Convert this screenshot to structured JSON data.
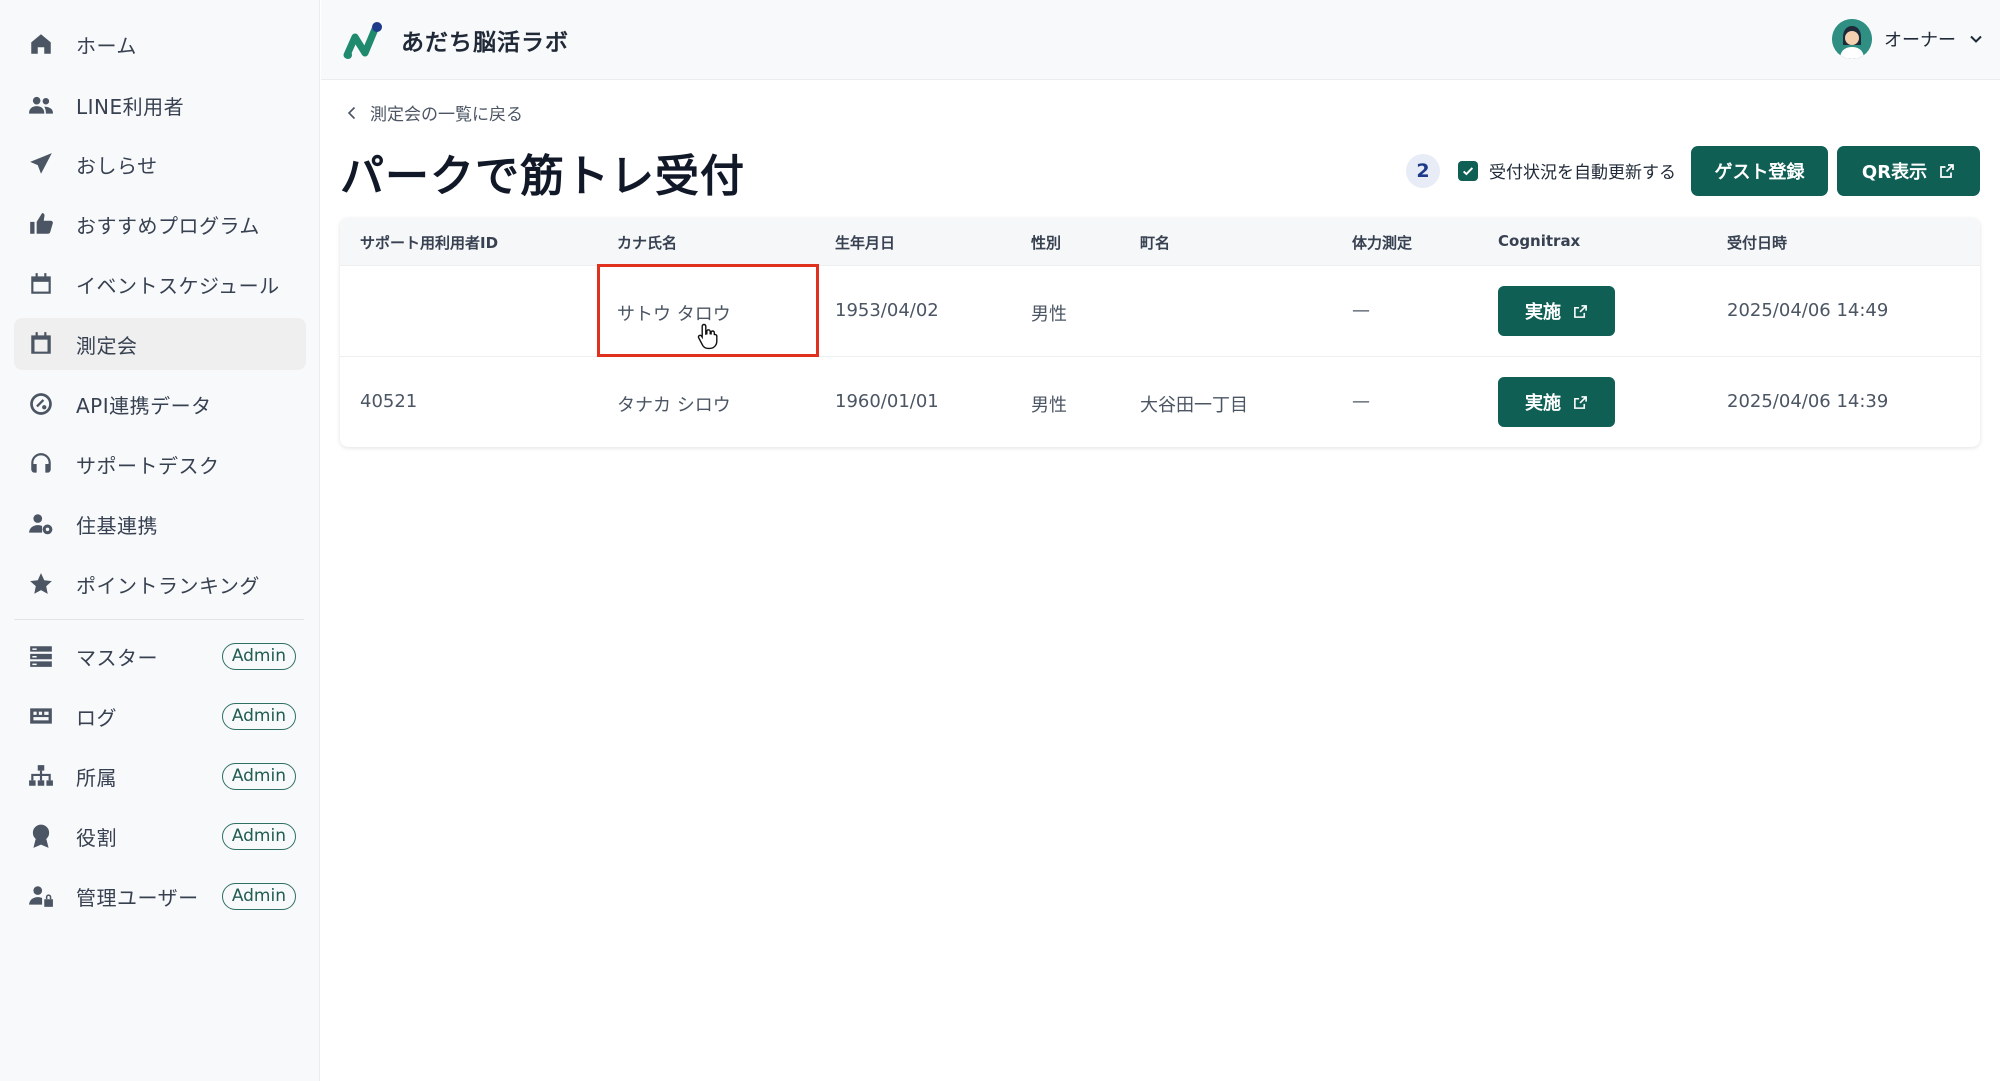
{
  "app": {
    "title": "あだち脳活ラボ"
  },
  "user": {
    "name": "オーナー"
  },
  "sidebar": {
    "items": [
      {
        "label": "ホーム"
      },
      {
        "label": "LINE利用者"
      },
      {
        "label": "おしらせ"
      },
      {
        "label": "おすすめプログラム"
      },
      {
        "label": "イベントスケジュール"
      },
      {
        "label": "測定会",
        "active": true
      },
      {
        "label": "API連携データ"
      },
      {
        "label": "サポートデスク"
      },
      {
        "label": "住基連携"
      },
      {
        "label": "ポイントランキング"
      }
    ],
    "admin_items": [
      {
        "label": "マスター",
        "badge": "Admin"
      },
      {
        "label": "ログ",
        "badge": "Admin"
      },
      {
        "label": "所属",
        "badge": "Admin"
      },
      {
        "label": "役割",
        "badge": "Admin"
      },
      {
        "label": "管理ユーザー",
        "badge": "Admin"
      }
    ]
  },
  "main": {
    "back_label": "測定会の一覧に戻る",
    "title": "パークで筋トレ受付",
    "count": "2",
    "auto_refresh_label": "受付状況を自動更新する",
    "auto_refresh_checked": true,
    "guest_button": "ゲスト登録",
    "qr_button": "QR表示"
  },
  "table": {
    "headers": [
      "サポート用利用者ID",
      "カナ氏名",
      "生年月日",
      "性別",
      "町名",
      "体力測定",
      "Cognitrax",
      "受付日時"
    ],
    "rows": [
      {
        "id": "",
        "kana": "サトウ タロウ",
        "birth": "1953/04/02",
        "gender": "男性",
        "town": "",
        "fitness": "—",
        "cognitrax": "実施",
        "received": "2025/04/06 14:49"
      },
      {
        "id": "40521",
        "kana": "タナカ シロウ",
        "birth": "1960/01/01",
        "gender": "男性",
        "town": "大谷田一丁目",
        "fitness": "—",
        "cognitrax": "実施",
        "received": "2025/04/06 14:39"
      }
    ]
  },
  "colors": {
    "primary": "#0f5f55",
    "highlight": "#e0301e",
    "sidebar_bg": "#f8f9fa"
  }
}
